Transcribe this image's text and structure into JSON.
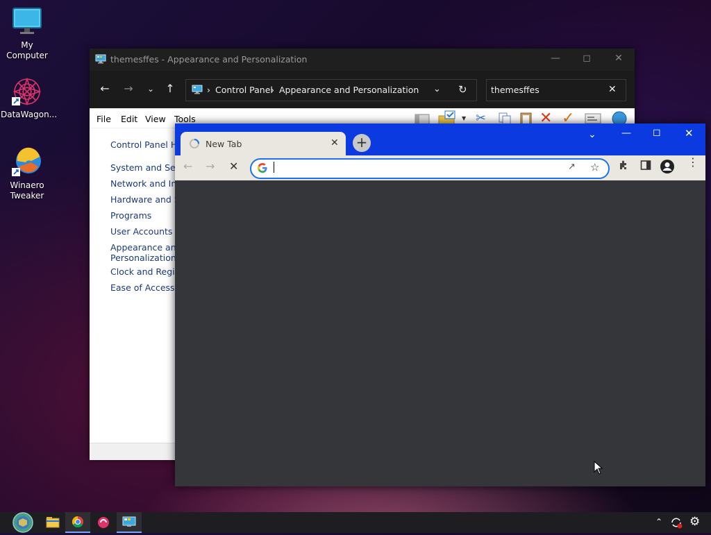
{
  "desktop": {
    "icons": [
      {
        "label": "My Computer"
      },
      {
        "label": "DataWagon..."
      },
      {
        "label": "Winaero Tweaker"
      }
    ]
  },
  "control_panel": {
    "title": "themesffes - Appearance and Personalization",
    "address": {
      "crumb1": "Control Panel",
      "crumb2": "Appearance and Personalization"
    },
    "search_value": "themesffes",
    "menu": {
      "file": "File",
      "edit": "Edit",
      "view": "View",
      "tools": "Tools"
    },
    "sidebar": {
      "home": "Control Panel Ho",
      "items": [
        "System and Secur",
        "Network and Inte",
        "Hardware and Sou",
        "Programs",
        "User Accounts",
        "Appearance and",
        "Personalization",
        "Clock and Region",
        "Ease of Access"
      ]
    }
  },
  "chrome": {
    "tab_title": "New Tab",
    "omnibox": {
      "value": ""
    },
    "accent": "#0a3ae0"
  },
  "colors": {
    "accent": "#0a3ae0",
    "link": "#1a3a78",
    "chrome_content": "#353639"
  }
}
